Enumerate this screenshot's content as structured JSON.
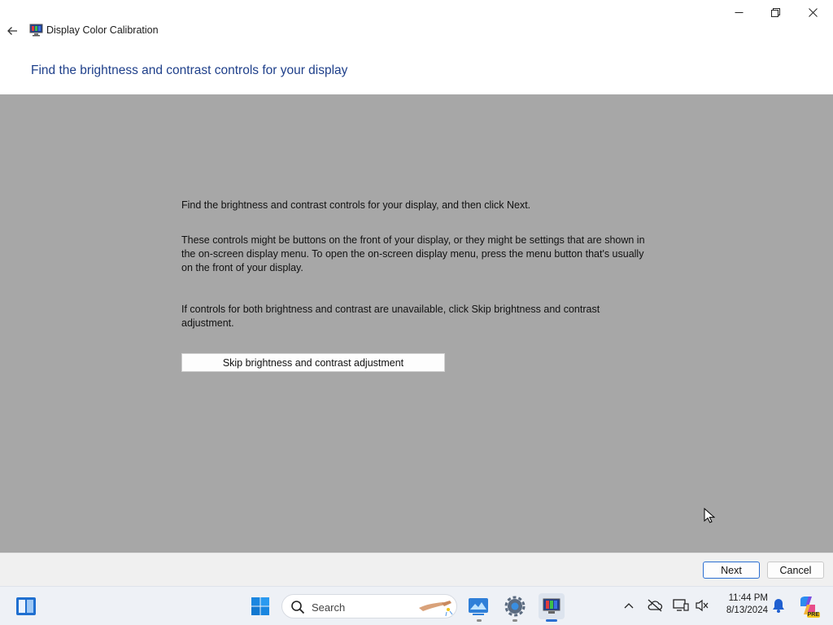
{
  "window": {
    "title": "Display Color Calibration",
    "heading": "Find the brightness and contrast controls for your display"
  },
  "content": {
    "paragraph1": "Find the brightness and contrast controls for your display, and then click Next.",
    "paragraph2": "These controls might be buttons on the front of your display, or they might be settings that are shown in the on-screen display menu. To open the on-screen display menu, press the menu button that's usually on the front of your display.",
    "paragraph3": "If controls for both brightness and contrast are unavailable, click Skip brightness and contrast adjustment.",
    "skip_button": "Skip brightness and contrast adjustment"
  },
  "footer": {
    "next_label": "Next",
    "cancel_label": "Cancel"
  },
  "taskbar": {
    "search_placeholder": "Search",
    "time": "11:44 PM",
    "date": "8/13/2024",
    "copilot_badge": "PRE"
  },
  "colors": {
    "heading": "#1e3f8a",
    "content_background": "#a7a7a7",
    "accent": "#2b6fd1"
  }
}
